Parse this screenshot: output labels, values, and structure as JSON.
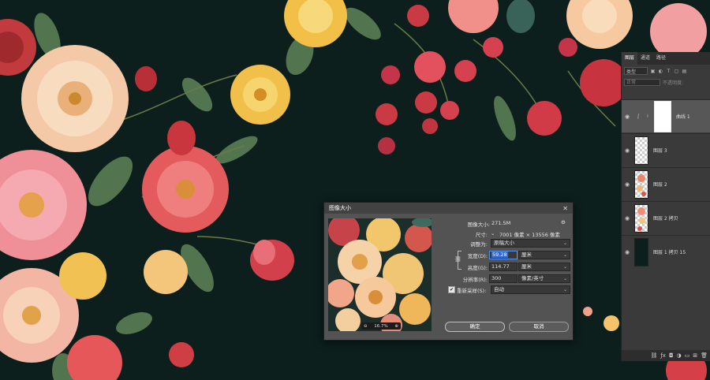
{
  "colors": {
    "canvas_bg": "#0c1f1d",
    "panel_bg": "#3a3a3a",
    "dialog_bg": "#535353",
    "accent_blue": "#2f6ad8"
  },
  "layers_panel": {
    "tabs": [
      "图层",
      "通道",
      "路径"
    ],
    "active_tab": 0,
    "kind_filter": "类型",
    "blend_mode": "正常",
    "opacity_label": "不透明度:",
    "layers": [
      {
        "name": "曲线 1",
        "type": "adjustment",
        "visible_icon": "eye-icon",
        "selected": true
      },
      {
        "name": "图层 3",
        "type": "transparent",
        "visible_icon": "eye-icon"
      },
      {
        "name": "图层 2",
        "type": "floral",
        "visible_icon": "eye-icon"
      },
      {
        "name": "图层 2 拷贝",
        "type": "floral",
        "visible_icon": "eye-icon"
      },
      {
        "name": "图层 1 拷贝 15",
        "type": "dark",
        "visible_icon": "eye-icon"
      }
    ],
    "footer_icons": [
      "link-icon",
      "fx-icon",
      "mask-icon",
      "adjustment-icon",
      "folder-icon",
      "new-layer-icon",
      "trash-icon"
    ]
  },
  "dialog": {
    "title": "图像大小",
    "close_glyph": "✕",
    "image_size_label": "图像大小:",
    "image_size_value": "271.5M",
    "dimensions_label": "尺寸:",
    "dimensions_value": "7001 像素 × 13556 像素",
    "fit_to_label": "调整为:",
    "fit_to_value": "原稿大小",
    "width_label": "宽度(D):",
    "width_value": "59.28",
    "width_unit": "厘米",
    "height_label": "高度(G):",
    "height_value": "114.77",
    "height_unit": "厘米",
    "resolution_label": "分辨率(R):",
    "resolution_value": "300",
    "resolution_unit": "像素/英寸",
    "resample_label": "重新采样(S):",
    "resample_checked": true,
    "resample_value": "自动",
    "zoom_value": "16.7%",
    "ok_label": "确定",
    "cancel_label": "取消"
  }
}
